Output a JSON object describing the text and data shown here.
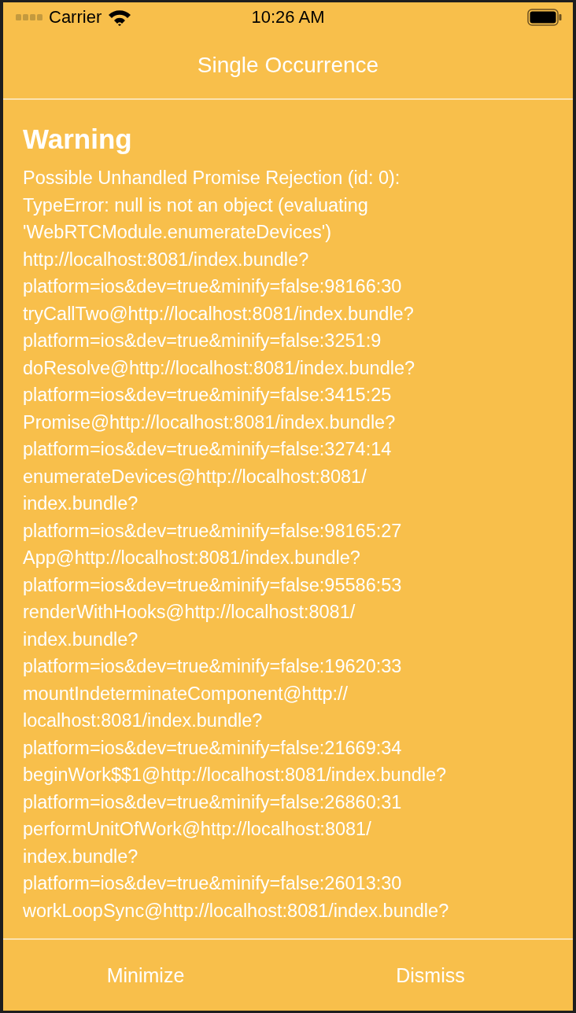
{
  "status_bar": {
    "carrier": "Carrier",
    "time": "10:26 AM"
  },
  "header": {
    "title": "Single Occurrence"
  },
  "log": {
    "level": "Warning",
    "message": "Possible Unhandled Promise Rejection (id: 0):\nTypeError: null is not an object (evaluating\n'WebRTCModule.enumerateDevices')\nhttp://localhost:8081/index.bundle?\nplatform=ios&dev=true&minify=false:98166:30\ntryCallTwo@http://localhost:8081/index.bundle?\nplatform=ios&dev=true&minify=false:3251:9\ndoResolve@http://localhost:8081/index.bundle?\nplatform=ios&dev=true&minify=false:3415:25\nPromise@http://localhost:8081/index.bundle?\nplatform=ios&dev=true&minify=false:3274:14\nenumerateDevices@http://localhost:8081/\nindex.bundle?\nplatform=ios&dev=true&minify=false:98165:27\nApp@http://localhost:8081/index.bundle?\nplatform=ios&dev=true&minify=false:95586:53\nrenderWithHooks@http://localhost:8081/\nindex.bundle?\nplatform=ios&dev=true&minify=false:19620:33\nmountIndeterminateComponent@http://\nlocalhost:8081/index.bundle?\nplatform=ios&dev=true&minify=false:21669:34\nbeginWork$$1@http://localhost:8081/index.bundle?\nplatform=ios&dev=true&minify=false:26860:31\nperformUnitOfWork@http://localhost:8081/\nindex.bundle?\nplatform=ios&dev=true&minify=false:26013:30\nworkLoopSync@http://localhost:8081/index.bundle?"
  },
  "footer": {
    "buttons": [
      "Minimize",
      "Dismiss"
    ]
  }
}
